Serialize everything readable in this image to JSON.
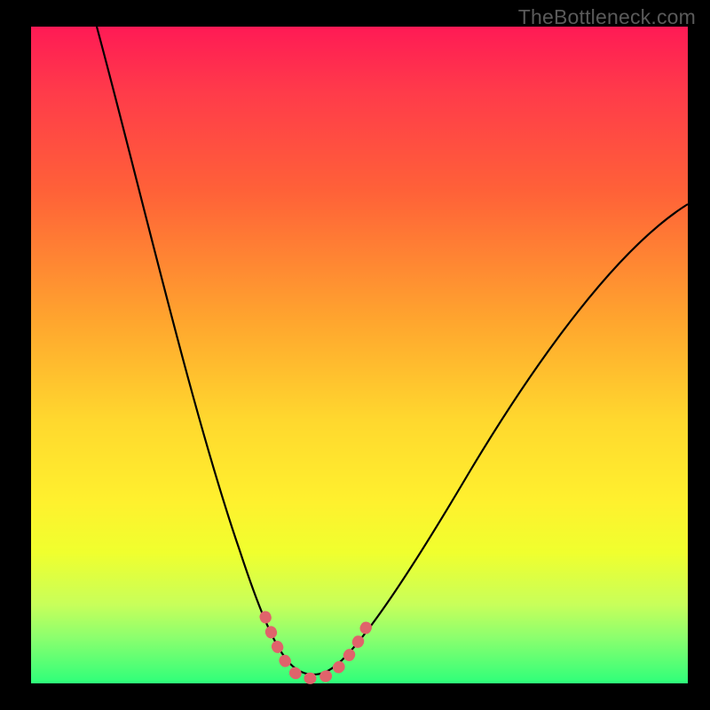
{
  "watermark": "TheBottleneck.com",
  "chart_data": {
    "type": "line",
    "title": "",
    "xlabel": "",
    "ylabel": "",
    "xlim": [
      0,
      100
    ],
    "ylim": [
      0,
      100
    ],
    "series": [
      {
        "name": "bottleneck-curve",
        "x": [
          10,
          15,
          20,
          25,
          30,
          33,
          36,
          38.5,
          40,
          42,
          44,
          46,
          50,
          55,
          60,
          65,
          70,
          75,
          80,
          85,
          90,
          95,
          100
        ],
        "y": [
          100,
          84,
          68,
          52,
          36,
          23,
          12,
          5,
          2,
          1,
          1,
          2,
          6,
          14,
          23,
          31,
          39,
          46,
          53,
          59,
          64,
          69,
          73
        ]
      }
    ],
    "highlight_segment": {
      "name": "valley-marker",
      "x": [
        36,
        38,
        40,
        42,
        44,
        46,
        48,
        50
      ],
      "y": [
        12,
        5,
        2,
        1,
        1,
        2,
        4,
        6
      ]
    },
    "background_gradient": {
      "top": "#ff1a55",
      "mid": "#ffd82e",
      "bottom": "#2eff7a"
    }
  }
}
